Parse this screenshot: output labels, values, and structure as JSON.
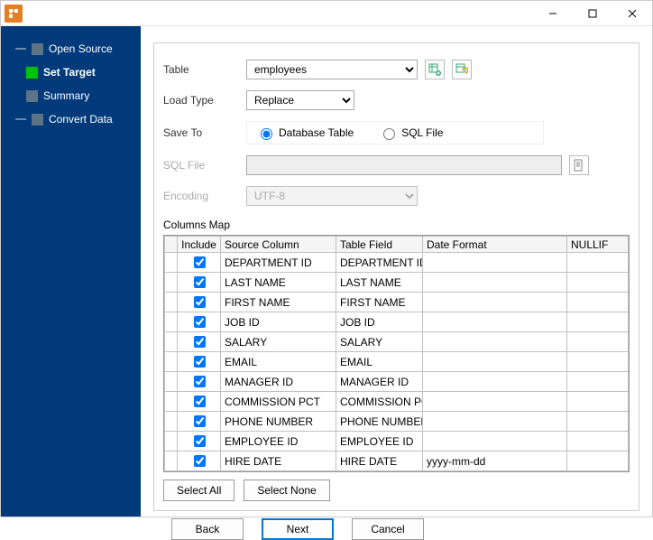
{
  "window": {
    "minimize": "—",
    "maximize": "☐",
    "close": "✕"
  },
  "sidebar": {
    "items": [
      {
        "label": "Open Source",
        "active": false,
        "indent": false
      },
      {
        "label": "Set Target",
        "active": true,
        "indent": true
      },
      {
        "label": "Summary",
        "active": false,
        "indent": true
      },
      {
        "label": "Convert Data",
        "active": false,
        "indent": false
      }
    ]
  },
  "form": {
    "table_label": "Table",
    "table_value": "employees",
    "load_label": "Load Type",
    "load_value": "Replace",
    "save_label": "Save To",
    "radio_db": "Database Table",
    "radio_sql": "SQL File",
    "sql_label": "SQL File",
    "sql_value": "",
    "enc_label": "Encoding",
    "enc_value": "UTF-8"
  },
  "icons": {
    "add_table": "add-table-icon",
    "refresh": "refresh-icon",
    "browse": "browse-file-icon"
  },
  "columns_map_label": "Columns Map",
  "grid": {
    "headers": {
      "include": "Include",
      "source": "Source Column",
      "target": "Table Field",
      "format": "Date Format",
      "nullif": "NULLIF"
    },
    "rows": [
      {
        "include": true,
        "source": "DEPARTMENT ID",
        "target": "DEPARTMENT ID",
        "format": "",
        "nullif": ""
      },
      {
        "include": true,
        "source": "LAST NAME",
        "target": "LAST NAME",
        "format": "",
        "nullif": ""
      },
      {
        "include": true,
        "source": "FIRST NAME",
        "target": "FIRST NAME",
        "format": "",
        "nullif": ""
      },
      {
        "include": true,
        "source": "JOB ID",
        "target": "JOB ID",
        "format": "",
        "nullif": ""
      },
      {
        "include": true,
        "source": "SALARY",
        "target": "SALARY",
        "format": "",
        "nullif": ""
      },
      {
        "include": true,
        "source": "EMAIL",
        "target": "EMAIL",
        "format": "",
        "nullif": ""
      },
      {
        "include": true,
        "source": "MANAGER ID",
        "target": "MANAGER ID",
        "format": "",
        "nullif": ""
      },
      {
        "include": true,
        "source": "COMMISSION PCT",
        "target": "COMMISSION PCT",
        "format": "",
        "nullif": ""
      },
      {
        "include": true,
        "source": "PHONE NUMBER",
        "target": "PHONE NUMBER",
        "format": "",
        "nullif": ""
      },
      {
        "include": true,
        "source": "EMPLOYEE ID",
        "target": "EMPLOYEE ID",
        "format": "",
        "nullif": ""
      },
      {
        "include": true,
        "source": "HIRE DATE",
        "target": "HIRE DATE",
        "format": "yyyy-mm-dd",
        "nullif": ""
      }
    ]
  },
  "buttons": {
    "select_all": "Select All",
    "select_none": "Select None",
    "back": "Back",
    "next": "Next",
    "cancel": "Cancel"
  }
}
